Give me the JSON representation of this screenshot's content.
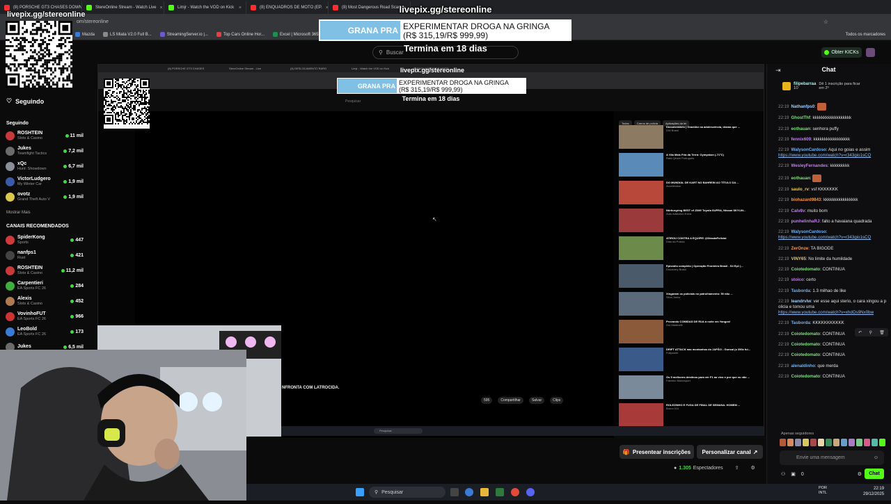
{
  "browser": {
    "tabs": [
      {
        "title": "(8) PORSCHE GT3 CHASES DOWN",
        "color": "#ff2d2d"
      },
      {
        "title": "StereOnline Stream - Watch Live",
        "color": "#53fc18"
      },
      {
        "title": "Limjr - Watch the VOD on Kick",
        "color": "#53fc18"
      },
      {
        "title": "(8) ENQUADROS DE MOTO (EP.",
        "color": "#ff2d2d"
      },
      {
        "title": "(8) Most Dangerous Road Scar",
        "color": "#ff2d2d"
      }
    ],
    "address": "om/stereonline",
    "bookmarks": [
      {
        "label": "Mazda",
        "color": "#3a7bd5"
      },
      {
        "label": "LS Miata V2.0 Full B...",
        "color": "#8a8a8a"
      },
      {
        "label": "StreamingServer.io |...",
        "color": "#6a5acd"
      },
      {
        "label": "Top Cars Online Hor...",
        "color": "#d44"
      },
      {
        "label": "Excel | Microsoft 365",
        "color": "#1d8f4e"
      }
    ],
    "bookmarks_right": "Todos os marcadores"
  },
  "overlay": {
    "url": "livepix.gg/stereonline",
    "banner_prefix": "GRANA PRA",
    "banner_line1": "EXPERIMENTAR DROGA NA GRINGA",
    "banner_line2": "(R$ 315,19/R$ 999,99)",
    "termina": "Termina em 18 dias"
  },
  "kick": {
    "search_placeholder": "Buscar",
    "obter_kicks": "Obter KICKs",
    "presentear": "Presentear inscrições",
    "personalizar": "Personalizar canal",
    "viewers_count": "1.305",
    "viewers_label": "Espectadores"
  },
  "sidebar": {
    "seguindo_title": "Seguindo",
    "seguindo_section": "Seguindo",
    "following": [
      {
        "name": "ROSHTEIN",
        "category": "Slots & Casino",
        "viewers": "11 mil",
        "color": "#c83a3a"
      },
      {
        "name": "Jukes",
        "category": "Teamfight Tactics",
        "viewers": "7,2 mil",
        "color": "#6b6b6b"
      },
      {
        "name": "xQc",
        "category": "Hunt: Showdown",
        "viewers": "6,7 mil",
        "color": "#8a8f99"
      },
      {
        "name": "VictorLudgero",
        "category": "My Winter Car",
        "viewers": "1,9 mil",
        "color": "#3b5aa8"
      },
      {
        "name": "ovotz",
        "category": "Grand Theft Auto V",
        "viewers": "1,9 mil",
        "color": "#d9c84a"
      }
    ],
    "mostrar_mais": "Mostrar Mais",
    "recomendados_title": "CANAIS RECOMENDADOS",
    "recommended": [
      {
        "name": "SpiderKong",
        "category": "Sports",
        "viewers": "447",
        "color": "#d13a3a"
      },
      {
        "name": "nanfps1",
        "category": "Rust",
        "viewers": "421",
        "color": "#444"
      },
      {
        "name": "ROSHTEIN",
        "category": "Slots & Casino",
        "viewers": "11,2 mil",
        "color": "#c83a3a"
      },
      {
        "name": "Carpentieri",
        "category": "EA Sports FC 26",
        "viewers": "284",
        "color": "#3fae3f"
      },
      {
        "name": "Alexis",
        "category": "Slots & Casino",
        "viewers": "452",
        "color": "#b07a50"
      },
      {
        "name": "VovinhoFUT",
        "category": "EA Sports FC 26",
        "viewers": "966",
        "color": "#c33"
      },
      {
        "name": "LeoBold",
        "category": "EA Sports FC 26",
        "viewers": "173",
        "color": "#3a7bd5"
      },
      {
        "name": "Jukes",
        "category": "",
        "viewers": "6,5 mil",
        "color": "#6b6b6b"
      }
    ]
  },
  "nested": {
    "tabs": [
      "(8) PORSCHE GT3 CHASES",
      "StereOnline Stream - Live",
      "(8) DESLOCAMENTO RARO",
      "Limjr - Watch the VOD on Kick",
      "(8) ENQUADROS DE MOTO"
    ],
    "url": "livepix.gg/stereonline",
    "banner_prefix": "GRANA PRA",
    "banner_line1": "EXPERIMENTAR DROGA NA GRINGA",
    "banner_line2": "(R$ 315,19/R$ 999,99)",
    "termina": "Termina em 18 dias",
    "search": "Pesquisar",
    "video_title": "NFRONTA COM LATROCIDA.",
    "actions": [
      "595",
      "Compartilhar",
      "Salvar",
      "Clips"
    ],
    "chips": [
      "Todos",
      "Carros de polícia",
      "Aplicações da lei"
    ],
    "recs": [
      {
        "title": "Documentário | Gravidez na adolescência, drama que ...",
        "channel": "DW Brasil",
        "color": "#8c7a63"
      },
      {
        "title": "A Vila Mais Fria da Terra: Oymyakon (-71°C)",
        "channel": "Rafa Qinzel Português",
        "color": "#5a8ab8"
      },
      {
        "title": "DO MUNDIAL DE KART NO BAHREIN AO TÍTULO DA ...",
        "channel": "Acceleratus",
        "color": "#b8483a"
      },
      {
        "title": "Nürburgring BEST of JDM! Toyota SUPRA, Nissan SKYLIN...",
        "channel": "Auto Addiction Extra",
        "color": "#9a3a3a"
      },
      {
        "title": "ATIROU CONTRA A EQUIPE! @DiasdaPolicial",
        "channel": "Dias da Policia",
        "color": "#6c8a4a"
      },
      {
        "title": "Episódio completo | Operação Fronteira Brasil - S4 Ep1 |...",
        "channel": "Discovery Brasil",
        "color": "#4a5a6a"
      },
      {
        "title": "Xingaram os policiais no patrulhamento: 50 não ...",
        "channel": "Silva Junior",
        "color": "#5a6a7a"
      },
      {
        "title": "Provando COMIDAS DE RUA à noite em Yangon!",
        "channel": "Gui Martinelli",
        "color": "#8a5a3a"
      },
      {
        "title": "DRIFT ATTACK nas montanhas do JAPÃO - Gunsai (o 350z fui...",
        "channel": "Fullpower",
        "color": "#3a5a8a"
      },
      {
        "title": "Os 5 melhores destinos para ver F1 ao vivo e por que eu não ...",
        "channel": "Fabinho Motorsport",
        "color": "#7a8a9a"
      },
      {
        "title": "ROLEZINHO E FUGA DE FINAL DE SEMANA. HOMEM ...",
        "channel": "Bruno 011",
        "color": "#a83a3a"
      }
    ]
  },
  "chat": {
    "title": "Chat",
    "pinned_user": "filipebarraa",
    "pinned_text": "Dê 1 inscrição para ficar em 2º",
    "pinned_count": "10",
    "messages": [
      {
        "time": "22:19",
        "user": "Nathanfps0",
        "color": "#9fd0ff",
        "text": "[emote]",
        "link": ""
      },
      {
        "time": "22:19",
        "user": "GhostThf",
        "color": "#7ee07e",
        "text": "kkkkkkkkkkkkkkkkkk",
        "link": ""
      },
      {
        "time": "22:19",
        "user": "eothauan",
        "color": "#7ee07e",
        "text": "senhora puffy",
        "link": ""
      },
      {
        "time": "22:19",
        "user": "fennix609",
        "color": "#c07ef0",
        "text": "kkkkkkkkkkkkkkkkk",
        "link": ""
      },
      {
        "time": "22:19",
        "user": "WalysonCardoso",
        "color": "#6fb3f2",
        "text": "Aqui no goias e assim",
        "link": "https://www.youtube.com/watch?v=r343gio1sCQ"
      },
      {
        "time": "22:19",
        "user": "WesleyFernandes",
        "color": "#c07ef0",
        "text": "kkkkkkkkk",
        "link": ""
      },
      {
        "time": "22:19",
        "user": "eothauan",
        "color": "#7ee07e",
        "text": "[emote]",
        "link": ""
      },
      {
        "time": "22:19",
        "user": "saulo_rv",
        "color": "#f2c94c",
        "text": "vsf KKKKKKK",
        "link": ""
      },
      {
        "time": "22:19",
        "user": "biohazard9843",
        "color": "#f2994a",
        "text": "kkkkkkkkkkkkkkkk",
        "link": ""
      },
      {
        "time": "22:19",
        "user": "Calv8v",
        "color": "#c07ef0",
        "text": "muito bom",
        "link": ""
      },
      {
        "time": "22:19",
        "user": "punhelinhaRJ",
        "color": "#c07ef0",
        "text": "falto a havaiana quadrada",
        "link": ""
      },
      {
        "time": "22:19",
        "user": "WalysonCardoso",
        "color": "#6fb3f2",
        "text": "",
        "link": "https://www.youtube.com/watch?v=r343gio1sCQ"
      },
      {
        "time": "22:19",
        "user": "ZerOnze",
        "color": "#f2994a",
        "text": "TA BIGODE",
        "link": ""
      },
      {
        "time": "22:19",
        "user": "VINY65",
        "color": "#f2c94c",
        "text": "No limite da humildade",
        "link": ""
      },
      {
        "time": "22:19",
        "user": "Coiotedomato",
        "color": "#7ee07e",
        "text": "CONTINUA",
        "link": ""
      },
      {
        "time": "22:19",
        "user": "stoico",
        "color": "#c07ef0",
        "text": "certo",
        "link": ""
      },
      {
        "time": "22:19",
        "user": "Tasborda",
        "color": "#6fb3f2",
        "text": "1.3 milhao de like",
        "link": ""
      },
      {
        "time": "22:19",
        "user": "leandrvlw",
        "color": "#9fd0ff",
        "text": "ver esse aqui sterio, o cara xingou a policia e tomou uma",
        "link": "https://www.youtube.com/watch?v=xhdOs9Nx0bw"
      },
      {
        "time": "22:19",
        "user": "Tasborda",
        "color": "#6fb3f2",
        "text": "KKKKKKKKKKK",
        "link": ""
      },
      {
        "time": "22:19",
        "user": "Coiotedomato",
        "color": "#7ee07e",
        "text": "CONTINUA",
        "link": ""
      },
      {
        "time": "22:19",
        "user": "Coiotedomato",
        "color": "#7ee07e",
        "text": "CONTINUA",
        "link": ""
      },
      {
        "time": "22:19",
        "user": "Coiotedomato",
        "color": "#7ee07e",
        "text": "CONTINUA",
        "link": ""
      },
      {
        "time": "22:19",
        "user": "alenaldinho",
        "color": "#6fb3f2",
        "text": "que merda",
        "link": ""
      },
      {
        "time": "22:19",
        "user": "Coiotedomato",
        "color": "#7ee07e",
        "text": "CONTINUA",
        "link": ""
      }
    ],
    "followers_only": "Apenas seguidores",
    "input_placeholder": "Envie uma mensagem",
    "points": "0",
    "send_label": "Chat"
  },
  "taskbar": {
    "search_placeholder": "Pesquisar",
    "lang_1": "POR",
    "lang_2": "INTL",
    "time": "22:19",
    "date": "29/12/2025"
  },
  "colors": {
    "kick_green": "#53fc18",
    "banner_blue": "#7fc0e4"
  }
}
